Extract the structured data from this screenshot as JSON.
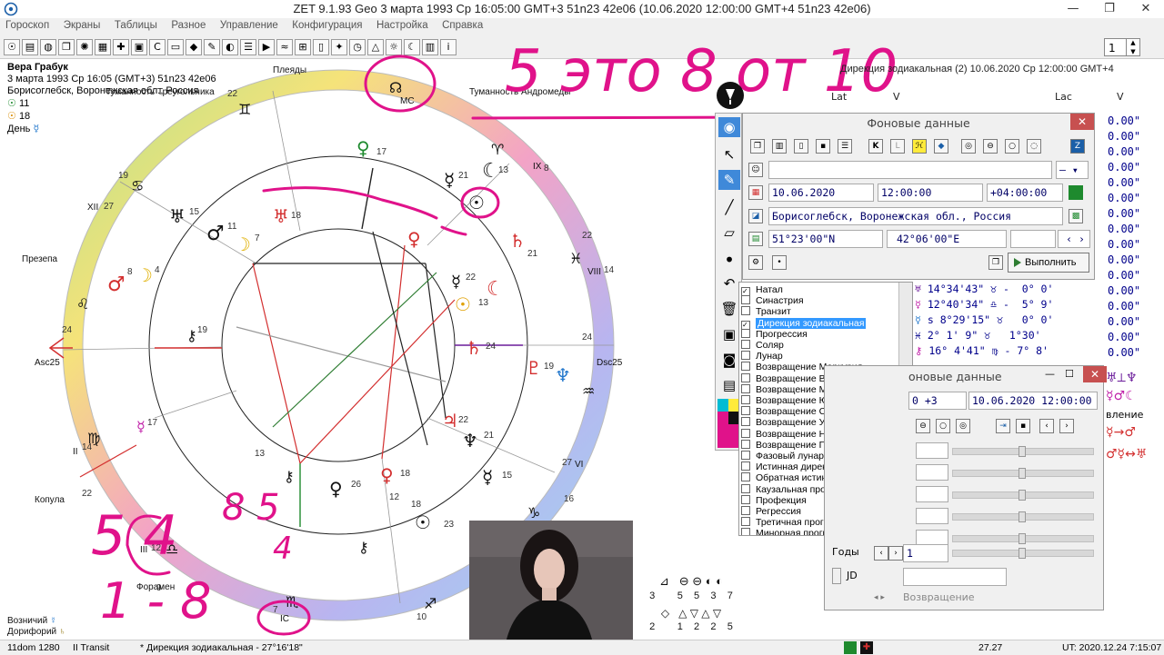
{
  "window": {
    "title": "ZET 9.1.93 Geo     3 марта 1993  Ср  16:05:00 GMT+3 51n23  42e06   (10.06.2020  12:00:00 GMT+4 51n23 42e06)",
    "min": "—",
    "max": "❐",
    "close": "✕"
  },
  "menu": [
    "Гороскоп",
    "Экраны",
    "Таблицы",
    "Разное",
    "Управление",
    "Конфигурация",
    "Настройка",
    "Справка"
  ],
  "toolbar": {
    "spin_value": "1"
  },
  "person": {
    "name": "Вера Грабук",
    "line1": "3 марта 1993  Ср  16:05 (GMT+3) 51n23  42e06",
    "line2": "Борисоглебск, Воронежская обл., Россия",
    "sun_value": "11",
    "moon_value": "18",
    "day_label": "День"
  },
  "chart": {
    "labels": {
      "pleiades": "Плеяды",
      "triangulum": "Туманность Треугольника",
      "andromeda": "Туманность Андромеды",
      "prezepa": "Презепа",
      "kopula": "Копула",
      "foramen": "Форамен",
      "asc": "Asc",
      "dsc": "Dsc",
      "mc": "MC",
      "ic": "IC",
      "asc_deg": "25",
      "dsc_deg": "25",
      "house_xii": "XII",
      "house_ix": "IX",
      "house_viii": "VIII",
      "house_vi": "VI",
      "house_ii": "II",
      "house_iii": "III"
    },
    "footer": {
      "voznichiy": "Возничий",
      "doriforiy": "Дорифорий"
    }
  },
  "direction_header": {
    "title": "Дирекция зодиакальная (2) 10.06.2020  Ср 12:00:00 GMT+4",
    "col_lat": "Lat",
    "col_v": "V",
    "col_lac": "Lac",
    "col_v2": "V"
  },
  "values": [
    "0.00\"",
    "0.00\"",
    "0.00\"",
    "0.00\"",
    "0.00\"",
    "0.00\"",
    "0.00\"",
    "0.00\"",
    "0.00\"",
    "0.00\"",
    "0.00\"",
    "0.00\"",
    "0.00\"",
    "0.00\"",
    "0.00\"",
    "0.00\""
  ],
  "aspect_rows": [
    {
      "a": "14°34'43\"",
      "b": "-  0° 0'"
    },
    {
      "a": "12°40'34\"",
      "b": "-  5° 9'"
    },
    {
      "a": "s 8°29'15\"",
      "b": "  0° 0'"
    },
    {
      "a": "2° 1' 9\"",
      "b": "  1°30'"
    },
    {
      "a": "16° 4'41\"",
      "b": "- 7° 8'"
    }
  ],
  "bg_panel": {
    "title": "Фоновые данные",
    "date": "10.06.2020",
    "time": "12:00:00",
    "tz": "+04:00:00",
    "place": "Борисоглебск, Воронежская обл., Россия",
    "lat": "51°23'00\"N",
    "lon": "42°06'00\"E",
    "exec": "Выполнить"
  },
  "modes": [
    {
      "label": "Натал",
      "checked": true,
      "selected": false
    },
    {
      "label": "Синастрия",
      "checked": false,
      "selected": false
    },
    {
      "label": "Транзит",
      "checked": false,
      "selected": false
    },
    {
      "label": "Дирекция зодиакальная",
      "checked": true,
      "selected": true
    },
    {
      "label": "Прогрессия",
      "checked": false,
      "selected": false
    },
    {
      "label": "Соляр",
      "checked": false,
      "selected": false
    },
    {
      "label": "Лунар",
      "checked": false,
      "selected": false
    },
    {
      "label": "Возвращение Меркурия",
      "checked": false,
      "selected": false
    },
    {
      "label": "Возвращение Венеры",
      "checked": false,
      "selected": false
    },
    {
      "label": "Возвращение Марса",
      "checked": false,
      "selected": false
    },
    {
      "label": "Возвращение Юпитера",
      "checked": false,
      "selected": false
    },
    {
      "label": "Возвращение Сатурна",
      "checked": false,
      "selected": false
    },
    {
      "label": "Возвращение Урана",
      "checked": false,
      "selected": false
    },
    {
      "label": "Возвращение Нептуна",
      "checked": false,
      "selected": false
    },
    {
      "label": "Возвращение Плутона",
      "checked": false,
      "selected": false
    },
    {
      "label": "Фазовый лунар",
      "checked": false,
      "selected": false
    },
    {
      "label": "Истинная дирекция",
      "checked": false,
      "selected": false
    },
    {
      "label": "Обратная истинная дирекция",
      "checked": false,
      "selected": false
    },
    {
      "label": "Каузальная прогрессия",
      "checked": false,
      "selected": false
    },
    {
      "label": "Профекция",
      "checked": false,
      "selected": false
    },
    {
      "label": "Регрессия",
      "checked": false,
      "selected": false
    },
    {
      "label": "Третичная прогрессия",
      "checked": false,
      "selected": false
    },
    {
      "label": "Минорная прогрессия",
      "checked": false,
      "selected": false
    }
  ],
  "bg_panel2": {
    "title": "оновые данные",
    "tz": "0 +3",
    "datetime": "10.06.2020   12:00:00  +4",
    "years_label": "Годы",
    "years_value": "1",
    "jd_label": "JD",
    "return_label": "Возвращение"
  },
  "right_edge": {
    "vl": "вление"
  },
  "bottom_counts": {
    "row1": [
      "3",
      "5",
      "5",
      "3",
      "7"
    ],
    "row2": [
      "2",
      "1",
      "2",
      "2",
      "5"
    ]
  },
  "status": {
    "s1": "11dom 1280",
    "s2": "II Transit",
    "s3": "*  Дирекция зодиакальная - 27°16'18\"",
    "s4": "27.27",
    "s5": "UT: 2020.12.24  7:15:07"
  },
  "handwriting": {
    "top": "5 это 8 от 10",
    "left1": "5 4",
    "left2": "1 - 8",
    "mid": "8 5",
    "mid2": "4",
    "note": "11"
  },
  "colors": {
    "selection": "#3399ff",
    "magenta": "#e0128a",
    "value_blue": "#00008b"
  }
}
